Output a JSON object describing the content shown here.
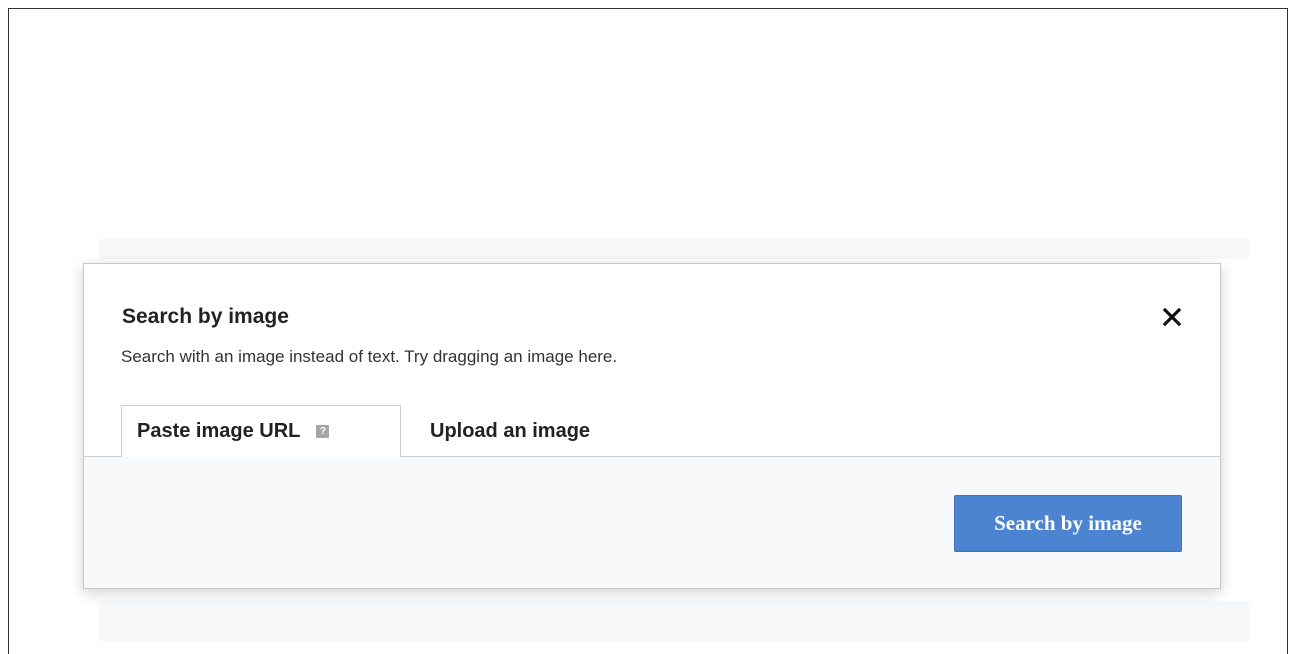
{
  "dialog": {
    "title": "Search by image",
    "subtitle": "Search  with an image instead of text. Try dragging an image here.",
    "close_icon": "close-icon",
    "tabs": [
      {
        "label": "Paste image URL",
        "active": true,
        "icon": "help-icon"
      },
      {
        "label": "Upload an image",
        "active": false
      }
    ],
    "url_input": {
      "value": "",
      "placeholder": ""
    },
    "search_button_label": "Search by image"
  },
  "colors": {
    "accent": "#4d84d1",
    "tab_body_bg": "#f7f9fb"
  }
}
